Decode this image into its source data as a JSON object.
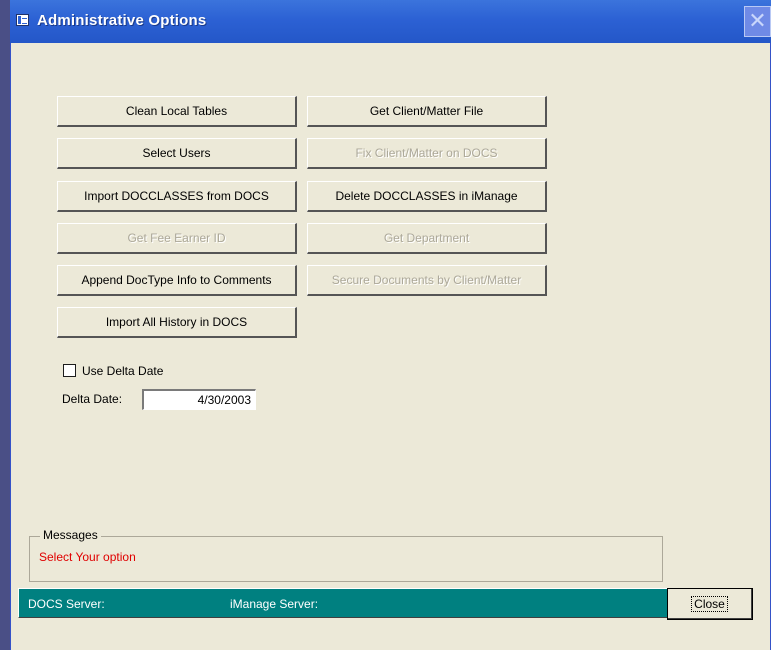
{
  "window": {
    "title": "Administrative Options",
    "title_icon": "form-icon",
    "close_glyph": "✕"
  },
  "buttons": {
    "clean_local_tables": "Clean Local Tables",
    "get_client_matter_file": "Get Client/Matter File",
    "select_users": "Select Users",
    "fix_client_matter": "Fix Client/Matter on DOCS",
    "import_docclasses": "Import DOCCLASSES from DOCS",
    "delete_docclasses": "Delete DOCCLASSES in iManage",
    "get_fee_earner_id": "Get Fee Earner ID",
    "get_department": "Get Department",
    "append_doctype": "Append DocType Info to Comments",
    "secure_documents": "Secure Documents by Client/Matter",
    "import_all_history": "Import All History in DOCS"
  },
  "delta": {
    "checkbox_label": "Use Delta Date",
    "checked": false,
    "date_label": "Delta Date:",
    "date_value": "4/30/2003"
  },
  "messages": {
    "legend": "Messages",
    "text": "Select Your option",
    "text_color": "#e00000"
  },
  "status": {
    "docs_server": "DOCS Server:",
    "imanage_server": "iManage Server:",
    "background": "#008080"
  },
  "close_button": "Close"
}
